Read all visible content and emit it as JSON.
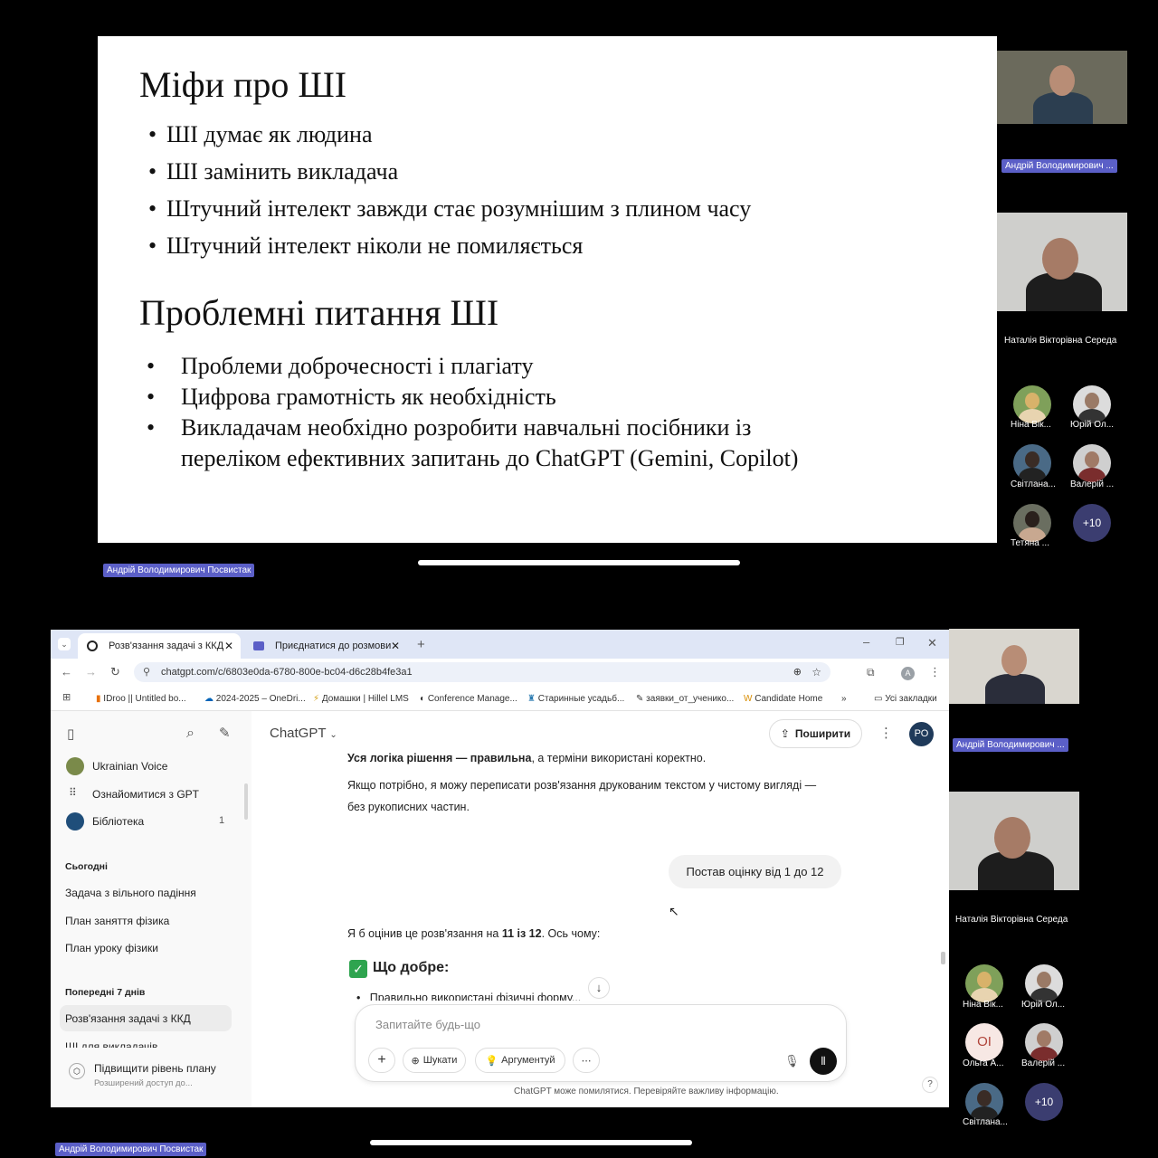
{
  "top_share": {
    "slide": {
      "heading1": "Міфи про ШІ",
      "myths": [
        "ШІ думає як людина",
        "ШІ замінить викладача",
        "Штучний інтелект завжди стає розумнішим з плином часу",
        "Штучний інтелект ніколи не помиляється"
      ],
      "heading2": "Проблемні питання ШІ",
      "issues": [
        "Проблеми доброчесності і плагіату",
        "Цифрова грамотність як необхідність",
        "Викладачам необхідно розробити навчальні посібники із",
        "переліком ефективних запитань до ChatGPT (Gemini, Copilot)"
      ]
    },
    "presenter_chip": "Андрій Володимирович Посвистак",
    "participants": {
      "p1": "Андрій Володимирович ...",
      "p2": "Наталія Вікторівна Середа",
      "a1": "Ніна Вік...",
      "a2": "Юрій Ол...",
      "a3": "Світлана...",
      "a4": "Валерій ...",
      "a5": "Тетяна ...",
      "more": "+10"
    }
  },
  "bottom_share": {
    "presenter_chip": "Андрій Володимирович Посвистак",
    "participants": {
      "p1": "Андрій Володимирович ...",
      "p2": "Наталія Вікторівна Середа",
      "a1": "Ніна Вік...",
      "a2": "Юрій Ол...",
      "a3": "Ольга А...",
      "a3_initials": "OI",
      "a4": "Валерій ...",
      "a5": "Світлана...",
      "more": "+10"
    }
  },
  "browser": {
    "tabs": [
      "Розв'язання задачі з ККД",
      "Приєднатися до розмови"
    ],
    "url": "chatgpt.com/c/6803e0da-6780-800e-bc04-d6c28b4fe3a1",
    "profile_letter": "A",
    "bookmarks": [
      "IDroo || Untitled bo...",
      "2024-2025 – OneDri...",
      "Домашки | Hillel LMS",
      "Conference Manage...",
      "Старинные усадьб...",
      "заявки_от_ученико...",
      "Candidate Home"
    ],
    "all_bookmarks": "Усі закладки",
    "sidebar": {
      "items": [
        "Ukrainian Voice",
        "Ознайомитися з GPT",
        "Бібліотека"
      ],
      "library_count": "1",
      "today_label": "Сьогодні",
      "today": [
        "Задача з вільного падіння",
        "План заняття фізика",
        "План уроку фізики"
      ],
      "week_label": "Попередні 7 днів",
      "week": [
        "Розв'язання задачі з ККД",
        "ШІ для викладачів"
      ],
      "upgrade_title": "Підвищити рівень плану",
      "upgrade_sub": "Розширений доступ до..."
    },
    "chat": {
      "model": "ChatGPT",
      "share": "Поширити",
      "avatar": "РО",
      "line1_bold": "Уся логіка рішення — правильна",
      "line1_rest": ", а терміни використані коректно.",
      "para2": "Якщо потрібно, я можу переписати розв'язання друкованим текстом у чистому вигляді — без рукописних частин.",
      "user_msg": "Постав оцінку від 1 до 12",
      "answer_pre": "Я б оцінив це розв'язання на ",
      "answer_bold": "11 із 12",
      "answer_post": ". Ось чому:",
      "good_heading": "Що добре:",
      "bullet1": "Правильно використані фізичні форму...",
      "placeholder": "Запитайте будь-що",
      "search_chip": "Шукати",
      "reason_chip": "Аргументуй",
      "disclaimer": "ChatGPT може помилятися. Перевіряйте важливу інформацію.",
      "help": "?"
    }
  }
}
